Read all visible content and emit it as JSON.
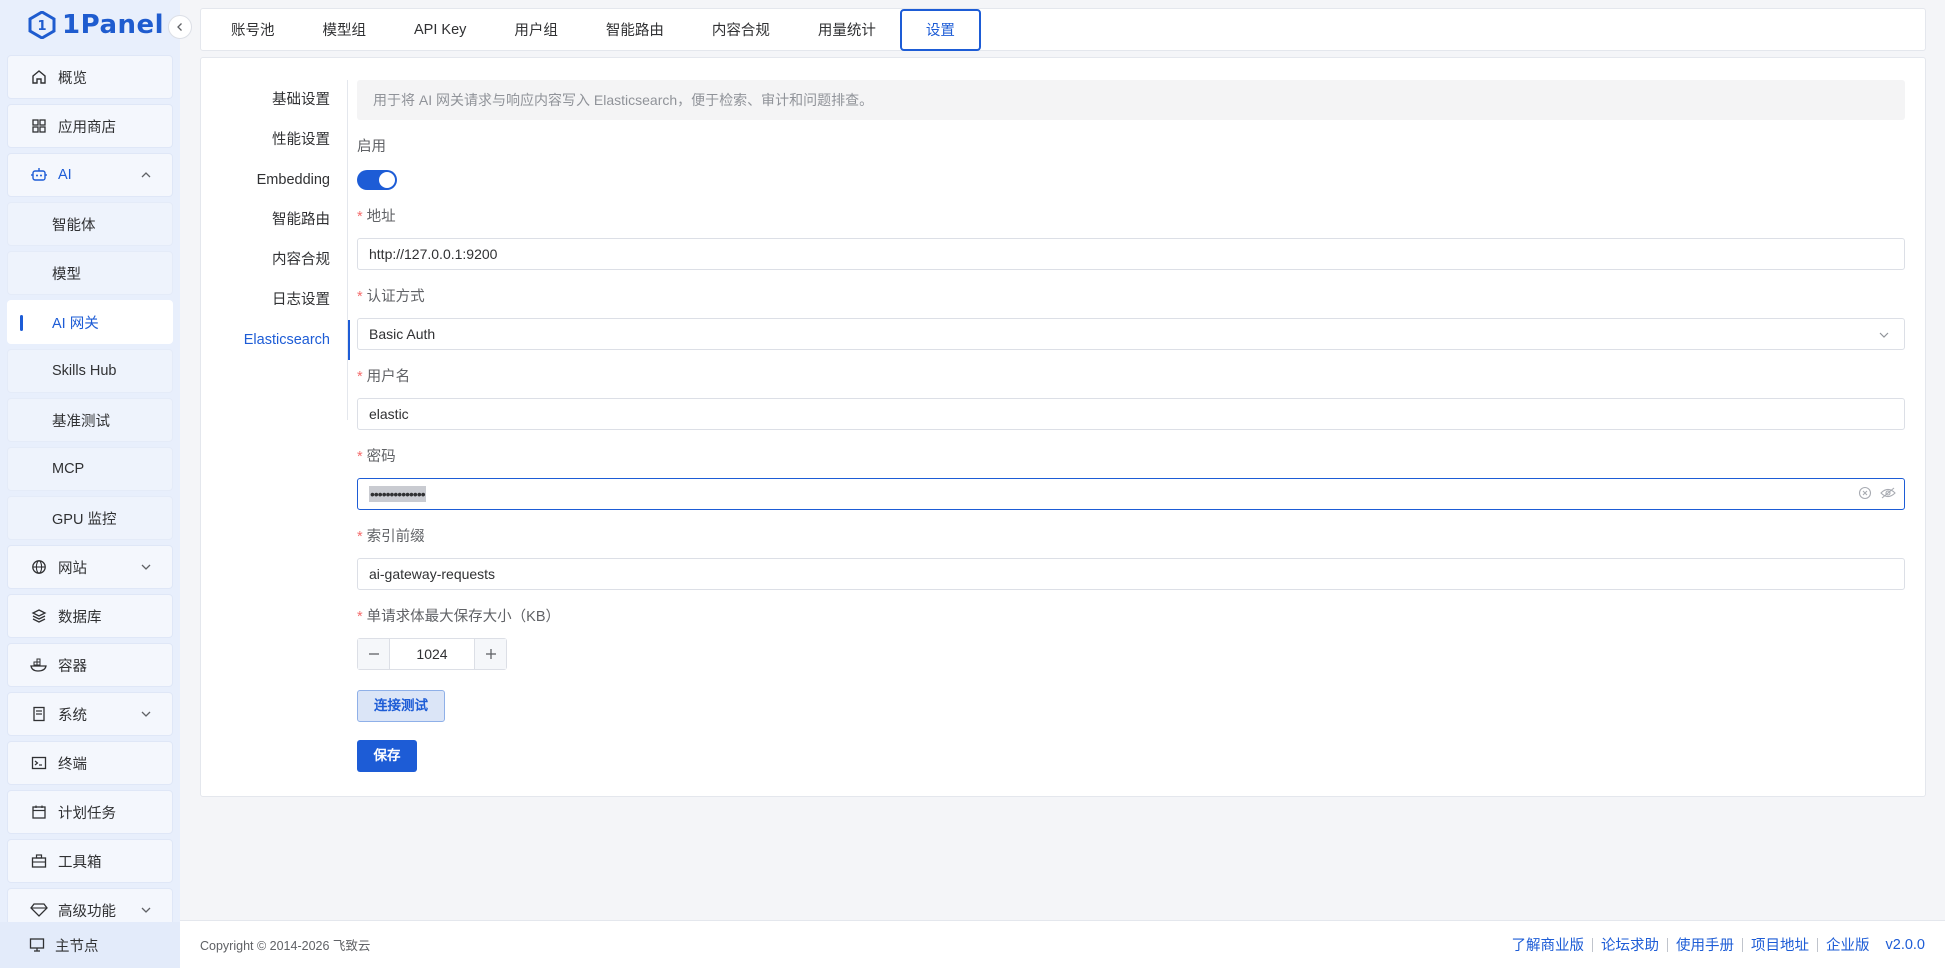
{
  "app": {
    "logo_text": "1Panel",
    "accent": "#1d5cd6"
  },
  "sidebar": {
    "items": [
      {
        "label": "概览",
        "icon": "home-icon"
      },
      {
        "label": "应用商店",
        "icon": "grid-icon"
      },
      {
        "label": "AI",
        "icon": "robot-icon"
      },
      {
        "label": "智能体"
      },
      {
        "label": "模型"
      },
      {
        "label": "AI 网关"
      },
      {
        "label": "Skills Hub"
      },
      {
        "label": "基准测试"
      },
      {
        "label": "MCP"
      },
      {
        "label": "GPU 监控"
      },
      {
        "label": "网站",
        "icon": "globe-icon"
      },
      {
        "label": "数据库",
        "icon": "layers-icon"
      },
      {
        "label": "容器",
        "icon": "container-icon"
      },
      {
        "label": "系统",
        "icon": "server-icon"
      },
      {
        "label": "终端",
        "icon": "terminal-icon"
      },
      {
        "label": "计划任务",
        "icon": "calendar-icon"
      },
      {
        "label": "工具箱",
        "icon": "toolbox-icon"
      },
      {
        "label": "高级功能",
        "icon": "diamond-icon"
      }
    ],
    "node_label": "主节点"
  },
  "tabs": [
    {
      "label": "账号池"
    },
    {
      "label": "模型组"
    },
    {
      "label": "API Key"
    },
    {
      "label": "用户组"
    },
    {
      "label": "智能路由"
    },
    {
      "label": "内容合规"
    },
    {
      "label": "用量统计"
    },
    {
      "label": "设置"
    }
  ],
  "settings_nav": [
    {
      "label": "基础设置"
    },
    {
      "label": "性能设置"
    },
    {
      "label": "Embedding"
    },
    {
      "label": "智能路由"
    },
    {
      "label": "内容合规"
    },
    {
      "label": "日志设置"
    },
    {
      "label": "Elasticsearch"
    }
  ],
  "form": {
    "notice": "用于将 AI 网关请求与响应内容写入 Elasticsearch，便于检索、审计和问题排查。",
    "enable_label": "启用",
    "enabled": true,
    "address_label": "地址",
    "address_value": "http://127.0.0.1:9200",
    "auth_label": "认证方式",
    "auth_value": "Basic Auth",
    "username_label": "用户名",
    "username_value": "elastic",
    "password_label": "密码",
    "password_value": "••••••••••••••",
    "index_label": "索引前缀",
    "index_value": "ai-gateway-requests",
    "maxsize_label": "单请求体最大保存大小（KB）",
    "maxsize_value": "1024",
    "test_button": "连接测试",
    "save_button": "保存"
  },
  "footer": {
    "copyright": "Copyright © 2014-2026 飞致云",
    "links": [
      "了解商业版",
      "论坛求助",
      "使用手册",
      "项目地址",
      "企业版"
    ],
    "version": "v2.0.0"
  }
}
